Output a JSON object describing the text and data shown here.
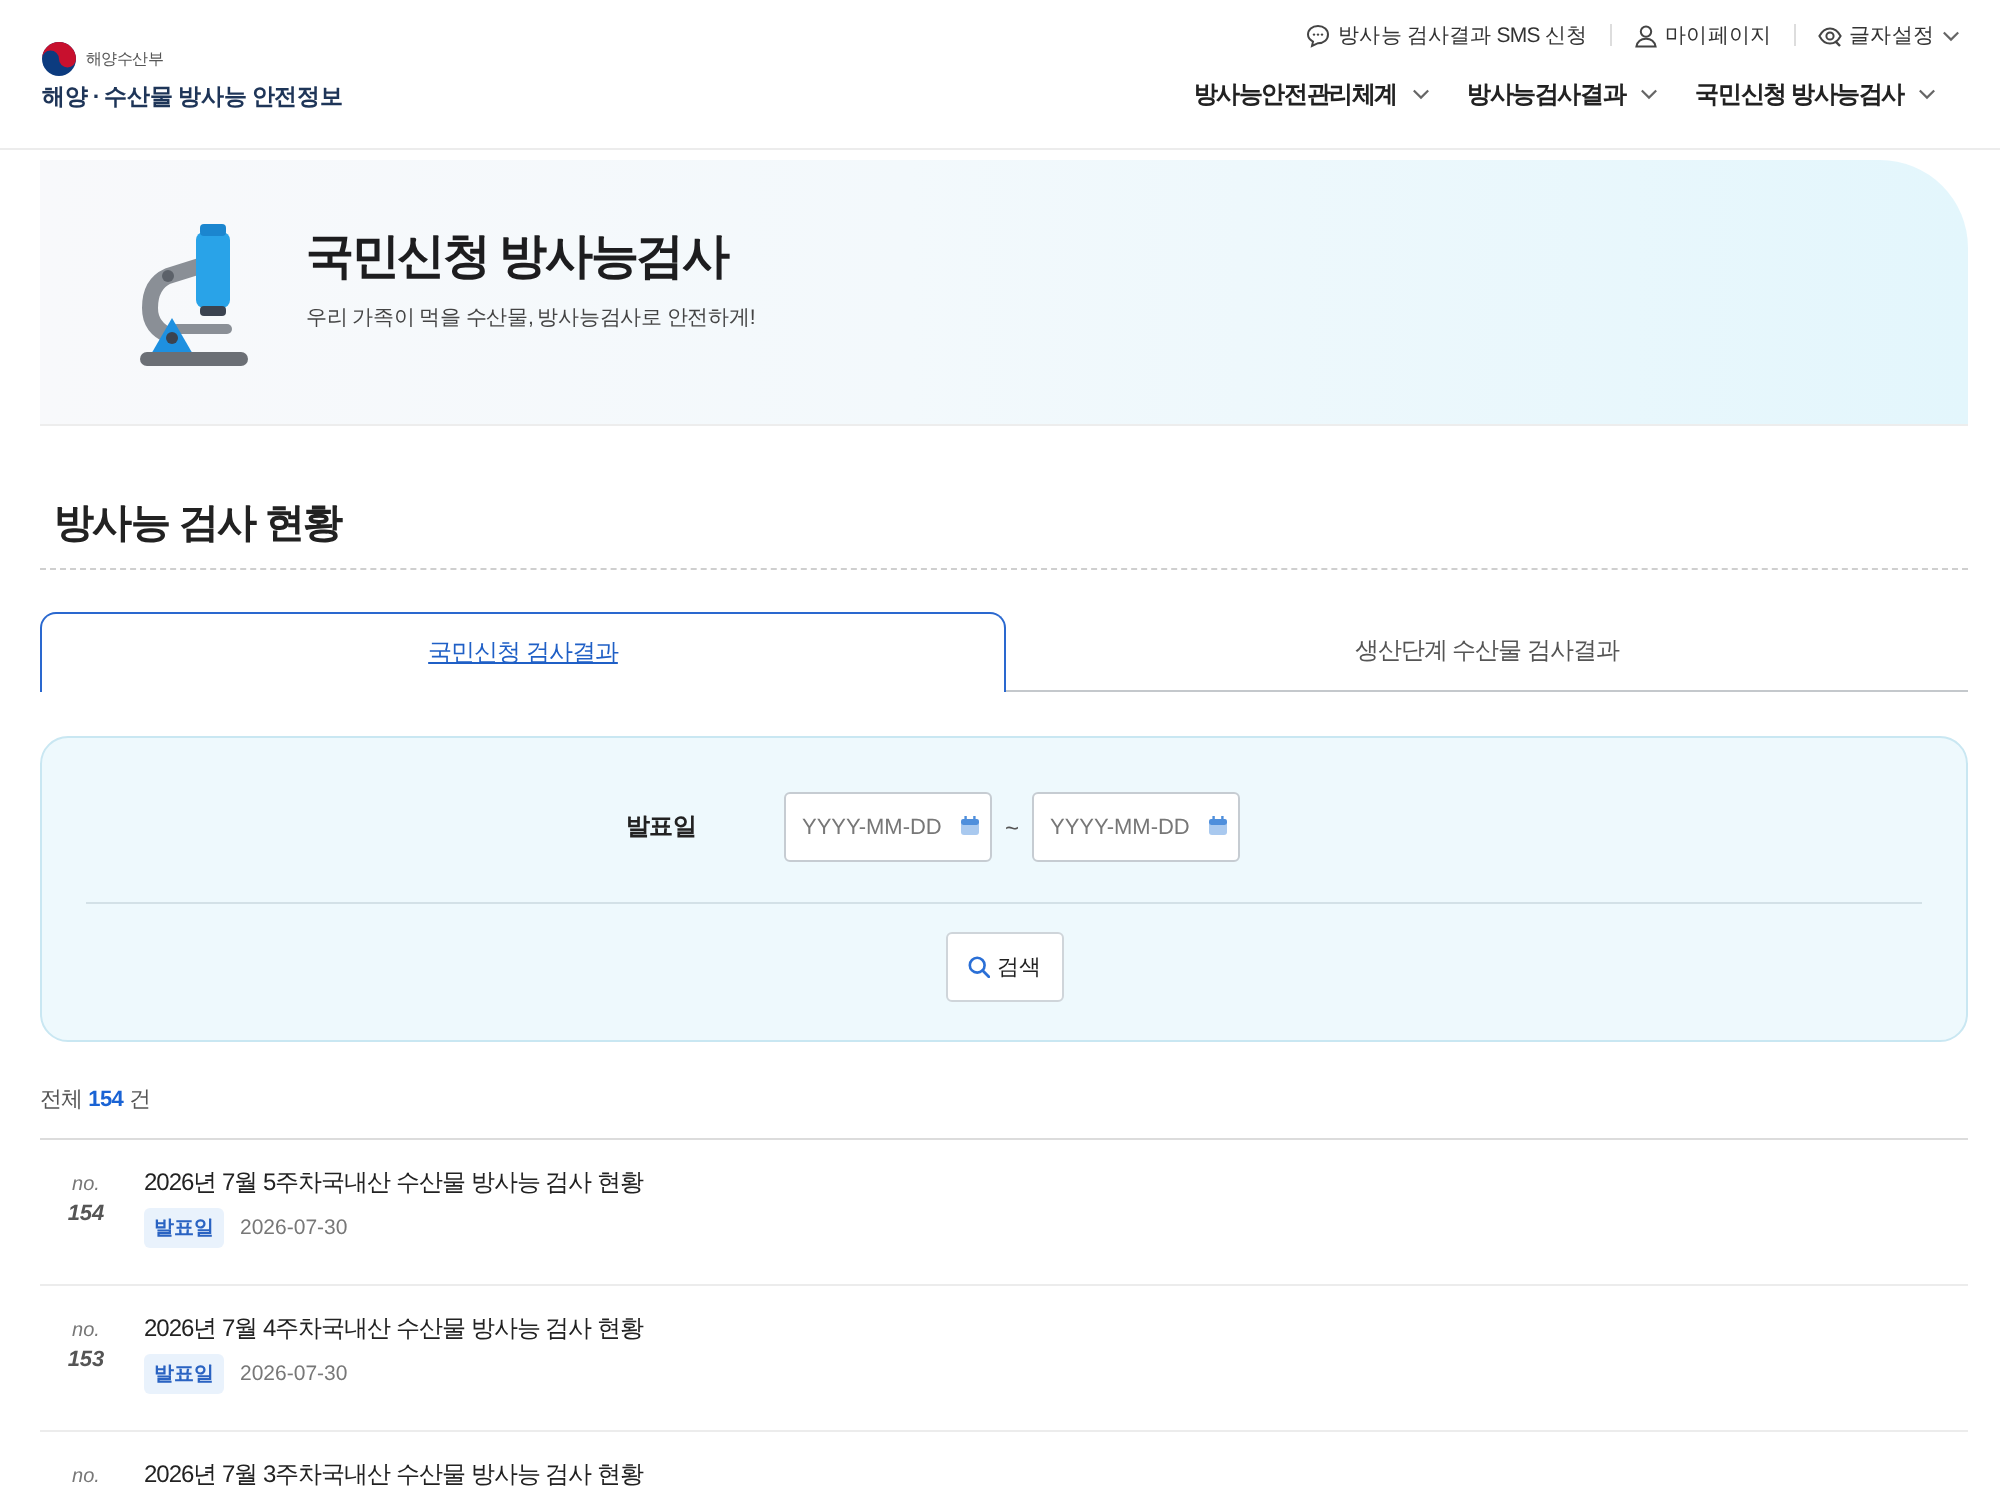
{
  "header": {
    "ministry": "해양수산부",
    "site_title": "해양 · 수산물 방사능 안전정보",
    "utility_links": [
      {
        "kind": "chat",
        "label": "방사능 검사결과 SMS 신청",
        "has_menu": false
      },
      {
        "kind": "person",
        "label": "마이페이지",
        "has_menu": false
      },
      {
        "kind": "eye",
        "label": "글자설정",
        "has_menu": true
      }
    ],
    "nav": [
      {
        "label": "방사능안전관리체계"
      },
      {
        "label": "방사능검사결과"
      },
      {
        "label": "국민신청 방사능검사"
      }
    ]
  },
  "hero": {
    "title": "국민신청 방사능검사",
    "subtitle": "우리 가족이 먹을 수산물, 방사능검사로 안전하게!"
  },
  "section_title": "방사능 검사 현황",
  "tabs": [
    {
      "label": "국민신청 검사결과",
      "selected": true
    },
    {
      "label": "생산단계 수산물 검사결과",
      "selected": false
    }
  ],
  "search": {
    "label": "발표일",
    "from": {
      "placeholder": "YYYY-MM-DD"
    },
    "separator": "~",
    "to": {
      "placeholder": "YYYY-MM-DD"
    },
    "button": "검색"
  },
  "total": "전체 **154** 건",
  "results": [
    {
      "no_label": "no.",
      "number": "154",
      "title": "2026년 7월 5주차국내산 수산물 방사능 검사 현황",
      "date_label": "발표일",
      "date": "2026-07-30"
    },
    {
      "no_label": "no.",
      "number": "153",
      "title": "2026년 7월 4주차국내산 수산물 방사능 검사 현황",
      "date_label": "발표일",
      "date": "2026-07-30"
    },
    {
      "no_label": "no.",
      "title": "2026년 7월 3주차국내산 수산물 방사능 검사 현황"
    }
  ]
}
